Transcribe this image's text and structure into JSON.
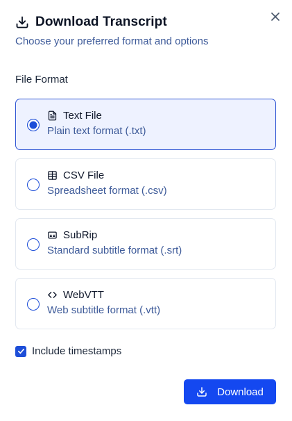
{
  "dialog": {
    "title": "Download Transcript",
    "subtitle": "Choose your preferred format and options",
    "title_icon": "download-icon",
    "close_icon": "close-icon"
  },
  "file_format": {
    "label": "File Format",
    "selected": "txt",
    "options": [
      {
        "id": "txt",
        "icon": "file-text-icon",
        "title": "Text File",
        "description": "Plain text format (.txt)",
        "selected": true
      },
      {
        "id": "csv",
        "icon": "table-icon",
        "title": "CSV File",
        "description": "Spreadsheet format (.csv)",
        "selected": false
      },
      {
        "id": "srt",
        "icon": "captions-icon",
        "title": "SubRip",
        "description": "Standard subtitle format (.srt)",
        "selected": false
      },
      {
        "id": "vtt",
        "icon": "code-icon",
        "title": "WebVTT",
        "description": "Web subtitle format (.vtt)",
        "selected": false
      }
    ]
  },
  "options": {
    "include_timestamps_label": "Include timestamps",
    "include_timestamps": true
  },
  "actions": {
    "download_label": "Download",
    "download_icon": "download-icon"
  },
  "colors": {
    "accent": "#1448f0",
    "selected_bg": "#eef2ff",
    "description_text": "#3d5a99"
  }
}
